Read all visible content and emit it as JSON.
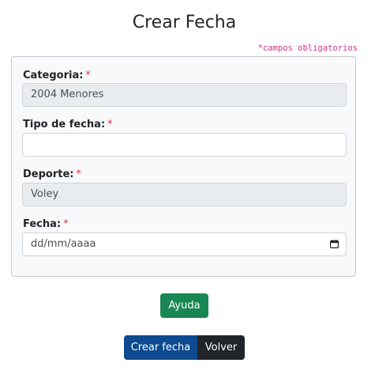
{
  "page": {
    "title": "Crear Fecha",
    "required_note": "*campos obligatorios"
  },
  "form": {
    "required_marker": "*",
    "categoria": {
      "label": "Categoria:",
      "value": "2004 Menores"
    },
    "tipo_fecha": {
      "label": "Tipo de fecha:",
      "value": ""
    },
    "deporte": {
      "label": "Deporte:",
      "value": "Voley"
    },
    "fecha": {
      "label": "Fecha:",
      "placeholder": "dd/mm/aaaa"
    }
  },
  "buttons": {
    "help_label": "Ayuda",
    "create_label": "Crear fecha",
    "back_label": "Volver"
  },
  "colors": {
    "help_button": "#198754",
    "create_button": "#0d4a8f",
    "back_button": "#212529",
    "required": "#dc3545",
    "note": "#d63384"
  },
  "icons": {
    "date_picker": "calendar-icon"
  }
}
